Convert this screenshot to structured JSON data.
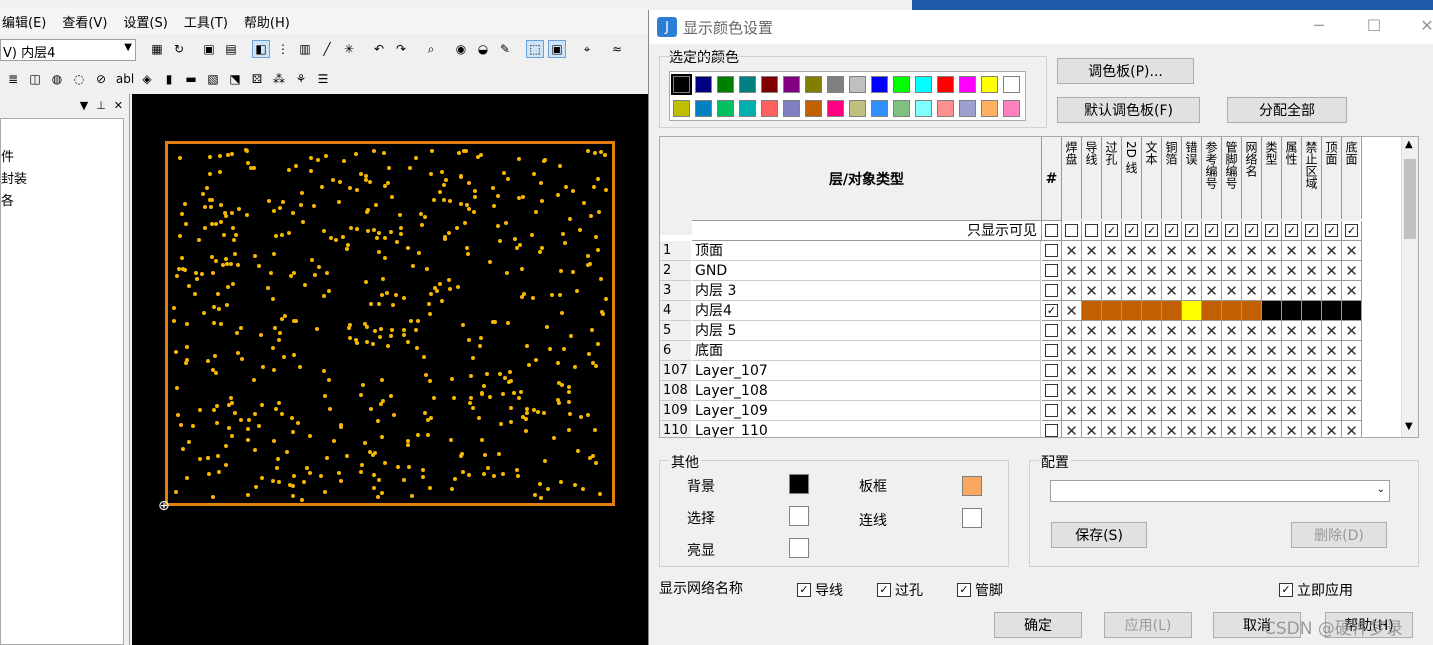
{
  "menu": [
    "编辑(E)",
    "查看(V)",
    "设置(S)",
    "工具(T)",
    "帮助(H)"
  ],
  "layer_combo": "V) 内层4",
  "tree": [
    "件",
    "封装",
    "各"
  ],
  "dialog": {
    "title": "显示颜色设置",
    "selected_color_label": "选定的颜色",
    "palette_btn": "调色板(P)...",
    "default_palette_btn": "默认调色板(F)",
    "assign_all_btn": "分配全部",
    "palette_row1": [
      "#000000",
      "#000080",
      "#008000",
      "#008080",
      "#800000",
      "#800080",
      "#808000",
      "#808080",
      "#c0c0c0",
      "#0000ff",
      "#00ff00",
      "#00ffff",
      "#ff0000",
      "#ff00ff",
      "#ffff00",
      "#ffffff"
    ],
    "palette_row2": [
      "#bfbf00",
      "#0080c0",
      "#00c060",
      "#00b0b0",
      "#ff6060",
      "#8080c0",
      "#c06000",
      "#ff0080",
      "#c0c080",
      "#3090ff",
      "#80c080",
      "#80ffff",
      "#ff9090",
      "#a0a0d0",
      "#ffb060",
      "#ff80c0"
    ],
    "grid": {
      "header": "层/对象类型",
      "hash": "#",
      "columns": [
        "焊盘",
        "导线",
        "过孔",
        "2D 线",
        "文本",
        "铜箔",
        "错误",
        "参考编号",
        "管脚编号",
        "网络名",
        "类型",
        "属性",
        "禁止区域",
        "顶面",
        "底面"
      ],
      "visible_only": "只显示可见",
      "rows": [
        {
          "num": "1",
          "name": "顶面"
        },
        {
          "num": "2",
          "name": "GND"
        },
        {
          "num": "3",
          "name": "内层 3"
        },
        {
          "num": "4",
          "name": "内层4"
        },
        {
          "num": "5",
          "name": "内层 5"
        },
        {
          "num": "6",
          "name": "底面"
        },
        {
          "num": "107",
          "name": "Layer_107"
        },
        {
          "num": "108",
          "name": "Layer_108"
        },
        {
          "num": "109",
          "name": "Layer_109"
        },
        {
          "num": "110",
          "name": "Layer_110"
        }
      ],
      "row4_colors": [
        "#c06000",
        "#c06000",
        "#c06000",
        "#c06000",
        "#c06000",
        "#ffff00",
        "#c06000",
        "#c06000",
        "#c06000",
        "#000000",
        "#000000",
        "#000000",
        "#000000",
        "#000000"
      ]
    },
    "other_label": "其他",
    "background_label": "背景",
    "select_label": "选择",
    "highlight_label": "亮显",
    "board_frame_label": "板框",
    "connection_label": "连线",
    "config_label": "配置",
    "save_btn": "保存(S)",
    "delete_btn": "删除(D)",
    "show_net_label": "显示网络名称",
    "chk_trace": "导线",
    "chk_via": "过孔",
    "chk_pin": "管脚",
    "chk_apply_now": "立即应用",
    "ok_btn": "确定",
    "apply_btn": "应用(L)",
    "cancel_btn": "取消",
    "help_btn": "帮助(H)",
    "colors": {
      "background": "#000000",
      "select": "#ffffff",
      "highlight": "#ffffff",
      "board_frame": "#f8a860",
      "connection": "#ffffff"
    }
  },
  "watermark": "CSDN @硬件梦录"
}
